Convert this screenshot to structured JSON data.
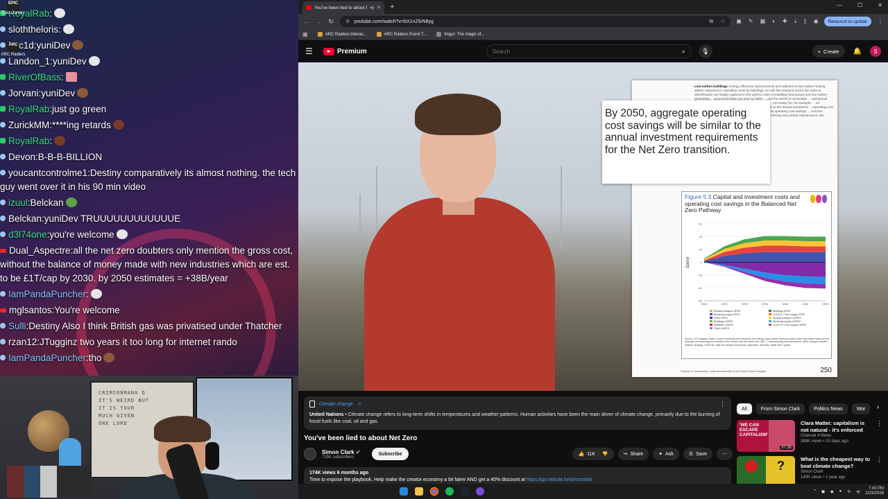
{
  "desktop": {
    "icons": [
      {
        "label": "Epic Games",
        "glyph": "EPIC"
      },
      {
        "label": "ARC Raiders",
        "glyph": "ARC"
      }
    ]
  },
  "chat": {
    "messages": [
      {
        "user": "RoyalRab",
        "text": "",
        "color": "green",
        "badge": "green",
        "emote": "pfp"
      },
      {
        "user": "sloththeloris",
        "text": "",
        "color": "white",
        "badge": "blue",
        "emote": "pfp"
      },
      {
        "user": "Luc1d",
        "text": "yuniDev",
        "color": "white",
        "badge": "blue",
        "emote": "face"
      },
      {
        "user": "Landon_1",
        "text": "yuniDev",
        "color": "white",
        "badge": "blue",
        "emote": "pfp"
      },
      {
        "user": "RiverOfBass",
        "text": "",
        "color": "green",
        "badge": "green",
        "emote": "pig"
      },
      {
        "user": "Jorvani",
        "text": "yuniDev",
        "color": "white",
        "badge": "blue",
        "emote": "face"
      },
      {
        "user": "RoyalRab",
        "text": "just go green",
        "color": "green",
        "badge": "green",
        "emote": ""
      },
      {
        "user": "ZurickMM",
        "text": "****ing retards",
        "color": "white",
        "badge": "blue",
        "emote": "ball"
      },
      {
        "user": "RoyalRab",
        "text": "",
        "color": "green",
        "badge": "green",
        "emote": "ball"
      },
      {
        "user": "Devon",
        "text": "B-B-B-BILLION",
        "color": "white",
        "badge": "blue",
        "emote": ""
      },
      {
        "user": "youcantcontrolme1",
        "text": "Destiny comparatively its almost nothing. the tech guy went over it in his 90 min video",
        "color": "white",
        "badge": "blue",
        "emote": ""
      },
      {
        "user": "izuul",
        "text": "Belckan",
        "color": "green",
        "badge": "blue",
        "emote": "pepe"
      },
      {
        "user": "Belckan",
        "text": "yuniDev TRUUUUUUUUUUUUE",
        "color": "white",
        "badge": "blue",
        "emote": ""
      },
      {
        "user": "d3l74one",
        "text": "you're welcome",
        "color": "green",
        "badge": "blue",
        "emote": "pfp"
      },
      {
        "user": "Dual_Aspectre",
        "text": "all the net zero doubters only mention the gross cost, without the balance of money made with new industries which are est. to be £1T/cap by 2030. by 2050 estimates = +38B/year",
        "color": "white",
        "badge": "red",
        "emote": ""
      },
      {
        "user": "IamPandaPuncher",
        "text": "",
        "color": "blue",
        "badge": "blue",
        "emote": "pfp"
      },
      {
        "user": "mglsantos",
        "text": "You're welcome",
        "color": "white",
        "badge": "red",
        "emote": ""
      },
      {
        "user": "Sulli",
        "text": "Destiny Also I think British gas was privatised under Thatcher",
        "color": "blue",
        "badge": "blue",
        "emote": ""
      },
      {
        "user": "rzan12",
        "text": "JTugginz two years it too long for internet rando",
        "color": "white",
        "badge": "blue",
        "emote": ""
      },
      {
        "user": "IamPandaPuncher",
        "text": "tho",
        "color": "blue",
        "badge": "blue",
        "emote": "face"
      }
    ]
  },
  "webcam": {
    "shelf_text": "CRIMSONMANA D\nIT'S WEIRD BUT\nIT IS YOUR\nMUCH GIVEN\nONE LORD"
  },
  "browser": {
    "tab_title": "You've been lied to about N",
    "url": "youtube.com/watch?v=bX1n25rN8yg",
    "relaunch_label": "Relaunch to update",
    "bookmarks": [
      "ARC Raiders Interac...",
      "ARC Raiders Event T...",
      "Imgur: The magic of..."
    ]
  },
  "youtube": {
    "logo": "Premium",
    "search_placeholder": "Search",
    "create_label": "Create",
    "avatar_letter": "S"
  },
  "video": {
    "callout": "By 2050, aggregate operating cost savings will be similar to the annual investment requirements for the Net Zero transition.",
    "doc_heading": "Low-carbon buildings.",
    "doc_body": "Energy efficiency improvements and switches to low-carbon heating deliver reductions in operating costs for buildings. As with the transport sector the costs of electrification are largely captured in the upfront costs of installing heat pumps and low-carbon generating ... around £8 billion per year by 2050. ... and the switch to renewable ... operational cost increases and ... ion tends to increase costs, as ... rom today (so, for example, ... for shipping). However, these are ... lectrification. ... similar to the annual investment ... Operating cost savings build ... out across the entire stock of ... ime that operating cost savings ... conomic activity. ... mand of fossil fuels, the savings ... such as refining and vehicle maintenance. We consider these issues in Chapter 6.",
    "fig_num": "Figure 5.3",
    "fig_title": "Capital and investment costs and operating cost savings in the Balanced Net Zero Pathway",
    "chart_ylabel": "£bn/yr",
    "legend": [
      "Surface transport OPEX",
      "Buildings OPEX",
      "Electricity supply OPEX",
      "LULUCF / Fuel supply OPEX",
      "Other OPEX",
      "Surface transport CAPEX",
      "Buildings CAPEX",
      "Electricity supply CAPEX",
      "Networks CAPEX",
      "LULUCF / Fuel supply CAPEX",
      "Other CAPEX"
    ],
    "fig_source": "Source: CCC analysis. Notes: Costs of electricity are included in the energy supply sector, whereas costs of other low-carbon fuels such as hydrogen and bioenergy are included in the sectors that use these fuels. M&C = manufacturing and construction. Other category includes aviation, shipping, GGRs etc, land use change and forestry, agriculture, removals, waste and F-gases.",
    "page_footer": "Chapter 5: Investment, costs and benefits of the Sixth Carbon Budget",
    "page_num": "250"
  },
  "chart_data": {
    "type": "area",
    "ylabel": "£bn/yr",
    "x": [
      2020,
      2025,
      2030,
      2035,
      2040,
      2045,
      2050
    ],
    "ylim": [
      -60,
      60
    ],
    "yticks": [
      60,
      40,
      20,
      0,
      -20,
      -40,
      -60
    ],
    "series": [
      {
        "name": "Buildings CAPEX",
        "values": [
          2,
          10,
          14,
          16,
          16,
          16,
          16
        ]
      },
      {
        "name": "Surface transport CAPEX",
        "values": [
          1,
          6,
          9,
          10,
          10,
          9,
          9
        ]
      },
      {
        "name": "Electricity supply CAPEX",
        "values": [
          2,
          5,
          7,
          8,
          8,
          8,
          8
        ]
      },
      {
        "name": "Other CAPEX",
        "values": [
          1,
          4,
          6,
          7,
          7,
          7,
          7
        ]
      },
      {
        "name": "Surface transport OPEX",
        "values": [
          0,
          -4,
          -10,
          -16,
          -20,
          -22,
          -23
        ]
      },
      {
        "name": "Buildings OPEX",
        "values": [
          0,
          -2,
          -5,
          -8,
          -10,
          -11,
          -11
        ]
      },
      {
        "name": "Other OPEX",
        "values": [
          0,
          -1,
          -3,
          -5,
          -6,
          -7,
          -7
        ]
      }
    ]
  },
  "info_card": {
    "topic": "Climate change",
    "source": "United Nations",
    "text": "Climate change refers to long-term shifts in temperatures and weather patterns. Human activities have been the main driver of climate change, primarily due to the burning of fossil fuels like coal, oil and gas."
  },
  "watch": {
    "title": "You've been lied to about Net Zero",
    "channel": "Simon Clark",
    "subs": "715K subscribers",
    "subscribe": "Subscribe",
    "likes": "11K",
    "share": "Share",
    "ask": "Ask",
    "save": "Save",
    "views": "174K views  6 months ago",
    "desc": "Time to expose the playbook. Help make the creator economy a bit fairer AND get a 40% discount at",
    "desc_link": "https://go.nebula.tv/simonclark"
  },
  "sidebar": {
    "chips": [
      "All",
      "From Simon Clark",
      "Politics News",
      "Wor"
    ],
    "recs": [
      {
        "title": "Clara Mattei: capitalism is not natural - it's enforced",
        "channel": "Channel 4 News",
        "meta": "389K views • 10 days ago",
        "duration": "37:35",
        "thumb_text": "'WE CAN ESCAPE CAPITALISM'"
      },
      {
        "title": "What is the cheapest way to beat climate change?",
        "channel": "Simon Clark",
        "meta": "140K views • 1 year ago",
        "duration": "",
        "thumb_text": ""
      }
    ]
  },
  "taskbar": {
    "time": "7:43 PM",
    "date": "2/23/2026"
  }
}
